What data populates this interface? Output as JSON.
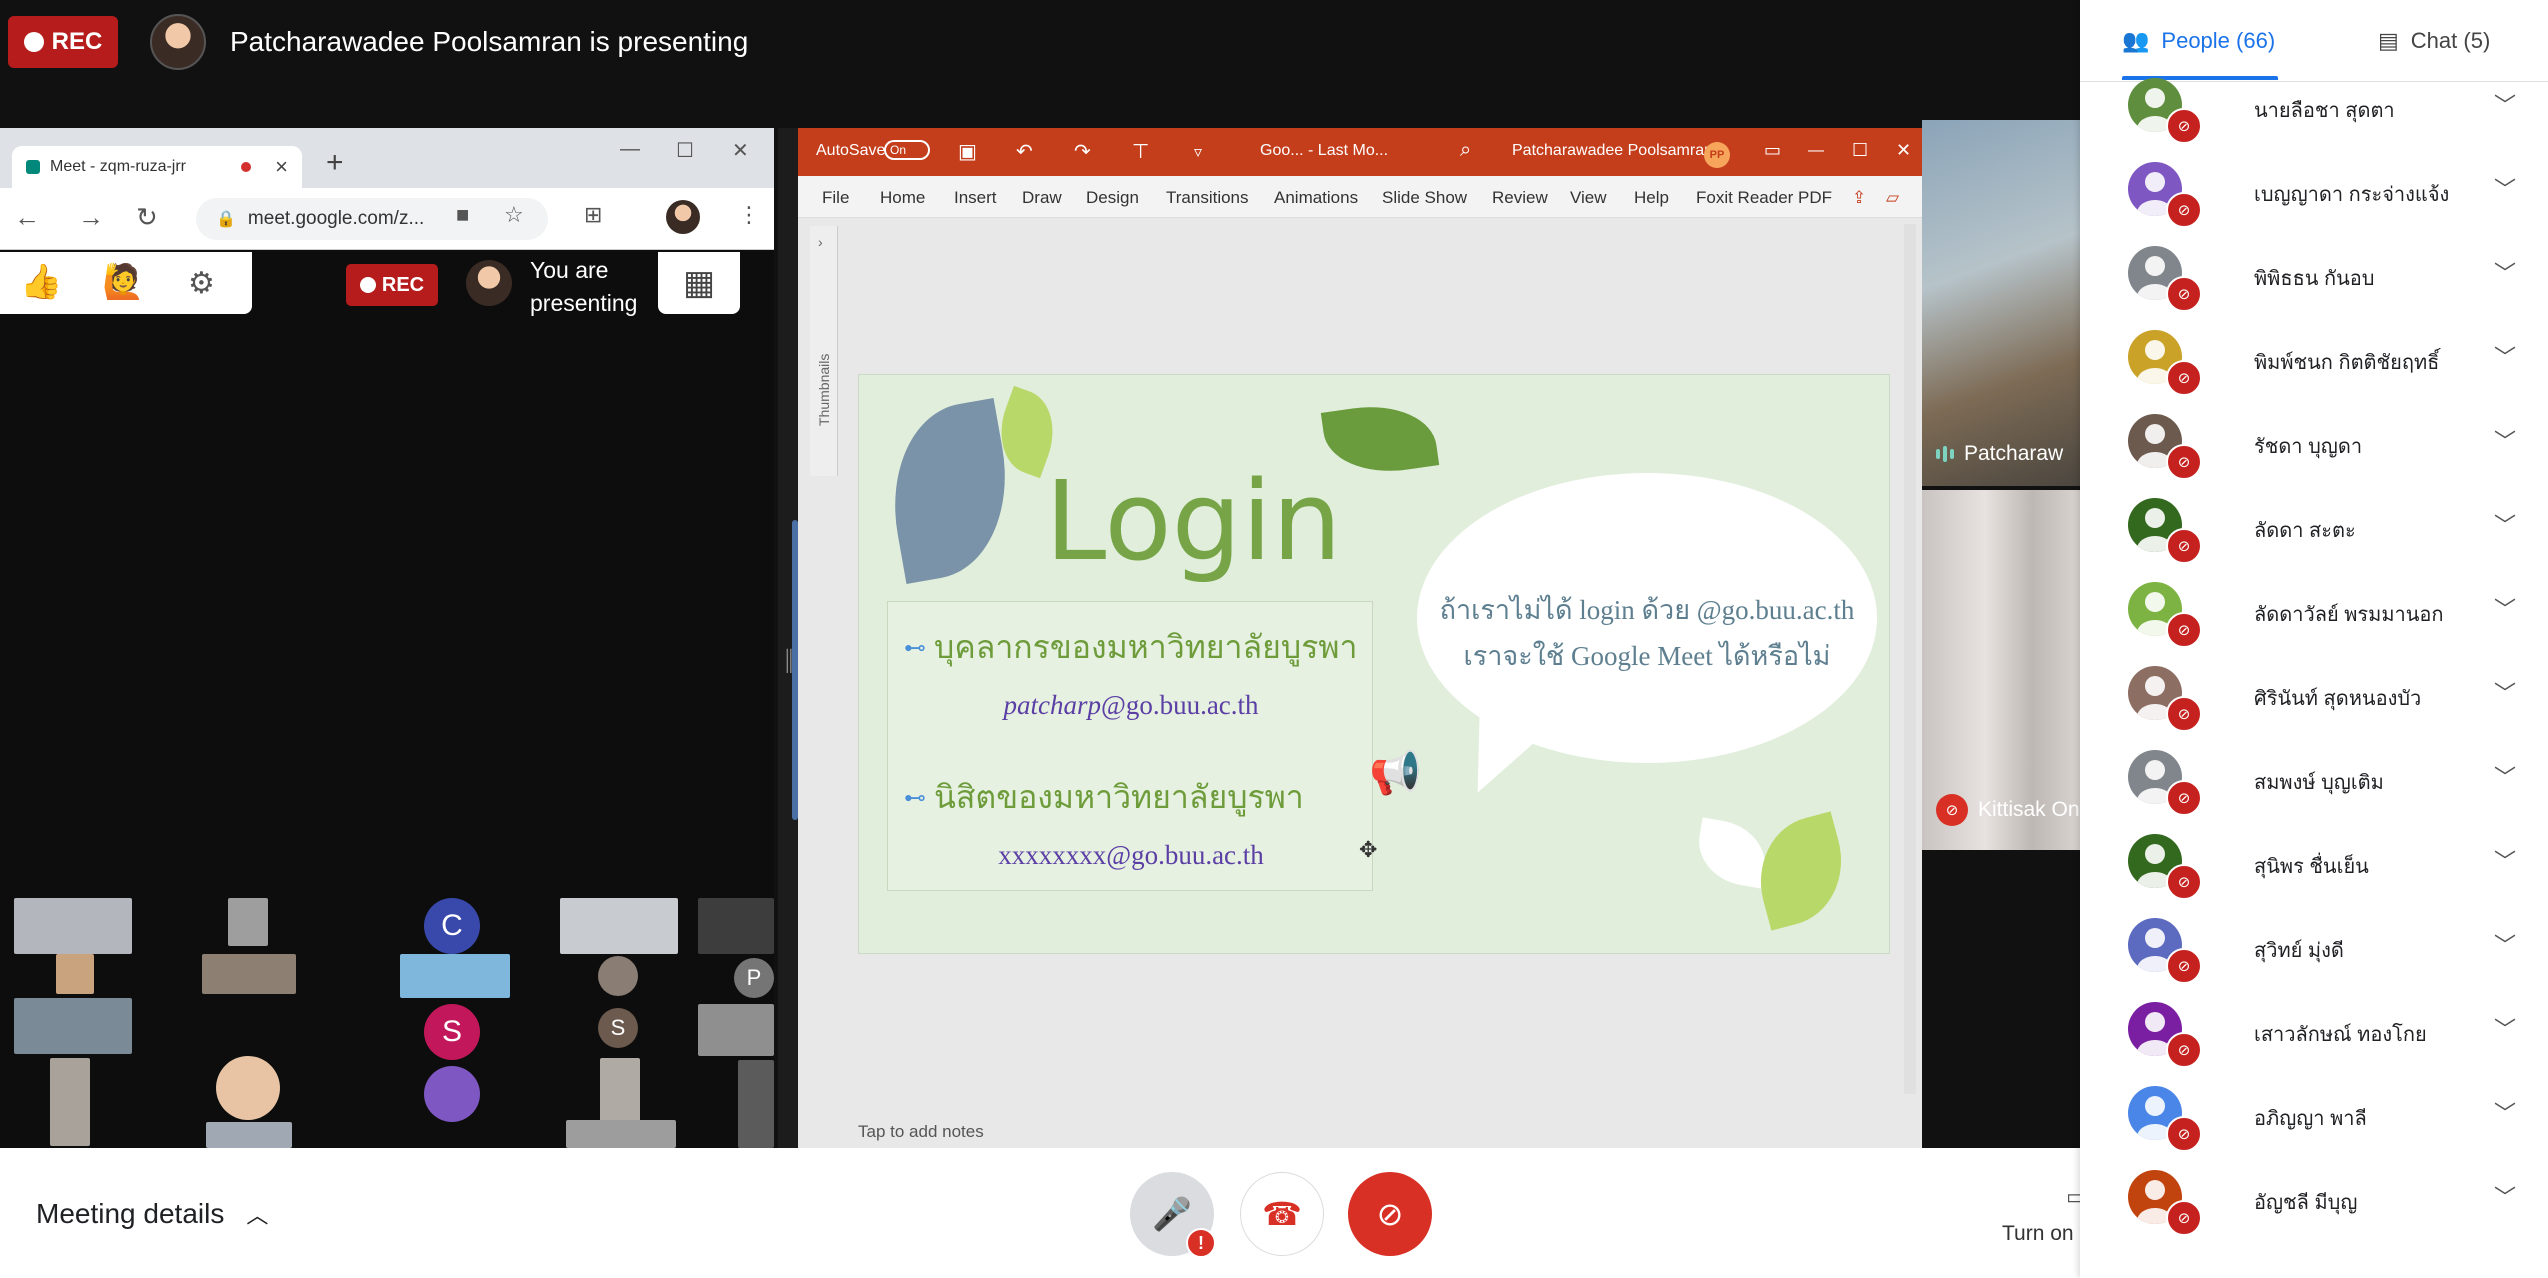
{
  "meet": {
    "rec_label": "REC",
    "presenting_text": "Patcharawadee Poolsamran is presenting"
  },
  "browser": {
    "tab_title": "Meet - zqm-ruza-jrr",
    "url": "meet.google.com/z...",
    "inner_rec_label": "REC",
    "inner_presenting": "You are presenting"
  },
  "thumbnails": {
    "letters": [
      "C",
      "S",
      "S",
      "P"
    ]
  },
  "ppt": {
    "autosave_label": "AutoSave",
    "autosave_state": "On",
    "doc_title": "Goo... - Last Mo...",
    "user_name": "Patcharawadee Poolsamran",
    "user_initials": "PP",
    "menu": [
      "File",
      "Home",
      "Insert",
      "Draw",
      "Design",
      "Transitions",
      "Animations",
      "Slide Show",
      "Review",
      "View",
      "Help",
      "Foxit Reader PDF"
    ],
    "thumbnails_label": "Thumbnails",
    "notes_placeholder": "Tap to add notes",
    "slide": {
      "title": "Login",
      "bullet1": "บุคลากรของมหาวิทยาลัยบูรพา",
      "email1_user": "patcharp",
      "email1_domain": "@go.buu.ac.th",
      "bullet2": "นิสิตของมหาวิทยาลัยบูรพา",
      "email2": "xxxxxxxx@go.buu.ac.th",
      "bubble_line1": "ถ้าเราไม่ได้ login ด้วย @go.buu.ac.th",
      "bubble_line2": "เราจะใช้ Google Meet ได้หรือไม่"
    }
  },
  "videos": {
    "speaker1": "Patcharaw",
    "speaker2": "Kittisak On"
  },
  "controls": {
    "meeting_details": "Meeting details",
    "captions_label": "Turn on c"
  },
  "panel": {
    "people_tab": "People (66)",
    "chat_tab": "Chat (5)",
    "people": [
      {
        "name": "นายลือชา สุดตา",
        "color": "#5f8f3e"
      },
      {
        "name": "เบญญาดา กระจ่างแจ้ง",
        "color": "#7e57c2"
      },
      {
        "name": "พิพิธธน กันอบ",
        "color": "#80868b"
      },
      {
        "name": "พิมพ์ชนก กิตติชัยฤทธิ์",
        "color": "#c9a227"
      },
      {
        "name": "รัชดา บุญดา",
        "color": "#6d5a4e"
      },
      {
        "name": "ลัดดา สะตะ",
        "color": "#33691e"
      },
      {
        "name": "ลัดดาวัลย์ พรมมานอก",
        "color": "#7cb342"
      },
      {
        "name": "ศิรินันท์ สุดหนองบัว",
        "color": "#8d6e63"
      },
      {
        "name": "สมพงษ์ บุญเติม",
        "color": "#80868b"
      },
      {
        "name": "สุนิพร ชื่นเย็น",
        "color": "#33691e"
      },
      {
        "name": "สุวิทย์ มุ่งดี",
        "color": "#5c6bc0"
      },
      {
        "name": "เสาวลักษณ์ ทองโกย",
        "color": "#7b1fa2"
      },
      {
        "name": "อภิญญา พาลี",
        "color": "#4a86e8"
      },
      {
        "name": "อัญชลี มีบุญ",
        "color": "#c1440e"
      }
    ]
  }
}
